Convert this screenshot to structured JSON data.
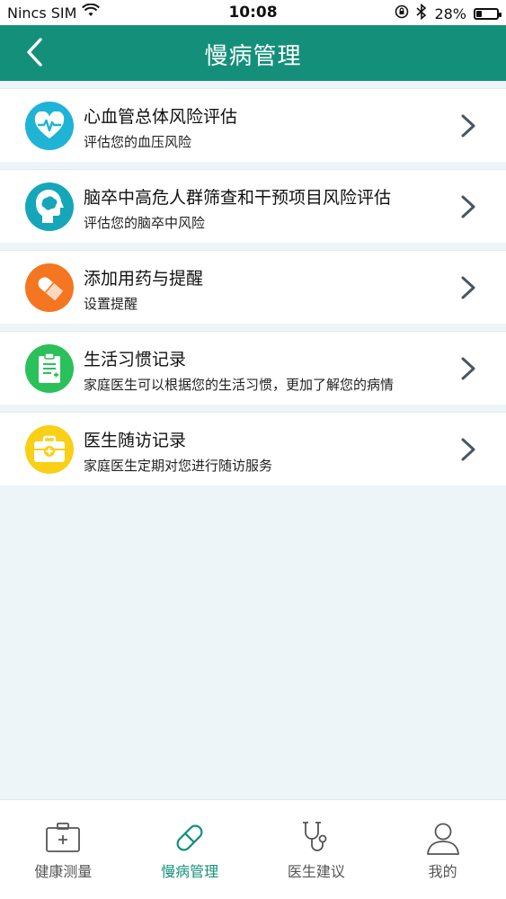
{
  "status_bar": {
    "carrier": "Nincs SIM",
    "time": "10:08",
    "battery": "28%",
    "battery_level": 0.28
  },
  "header": {
    "title": "慢病管理"
  },
  "items": [
    {
      "title": "心血管总体风险评估",
      "subtitle": "评估您的血压风险",
      "icon": "heart-pulse-icon",
      "color": "#1fb3d6"
    },
    {
      "title": "脑卒中高危人群筛查和干预项目风险评估",
      "subtitle": "评估您的脑卒中风险",
      "icon": "brain-head-icon",
      "color": "#16a6b9"
    },
    {
      "title": "添加用药与提醒",
      "subtitle": "设置提醒",
      "icon": "pill-icon",
      "color": "#f47621"
    },
    {
      "title": "生活习惯记录",
      "subtitle": "家庭医生可以根据您的生活习惯，更加了解您的病情",
      "icon": "clipboard-icon",
      "color": "#2ac05a"
    },
    {
      "title": "医生随访记录",
      "subtitle": "家庭医生定期对您进行随访服务",
      "icon": "medical-kit-icon",
      "color": "#f9cf17"
    }
  ],
  "tabs": [
    {
      "label": "健康测量",
      "icon": "medical-box-icon",
      "active": false
    },
    {
      "label": "慢病管理",
      "icon": "pill-outline-icon",
      "active": true
    },
    {
      "label": "医生建议",
      "icon": "stethoscope-icon",
      "active": false
    },
    {
      "label": "我的",
      "icon": "user-icon",
      "active": false
    }
  ],
  "colors": {
    "primary": "#14907a",
    "background": "#eef5f9"
  }
}
